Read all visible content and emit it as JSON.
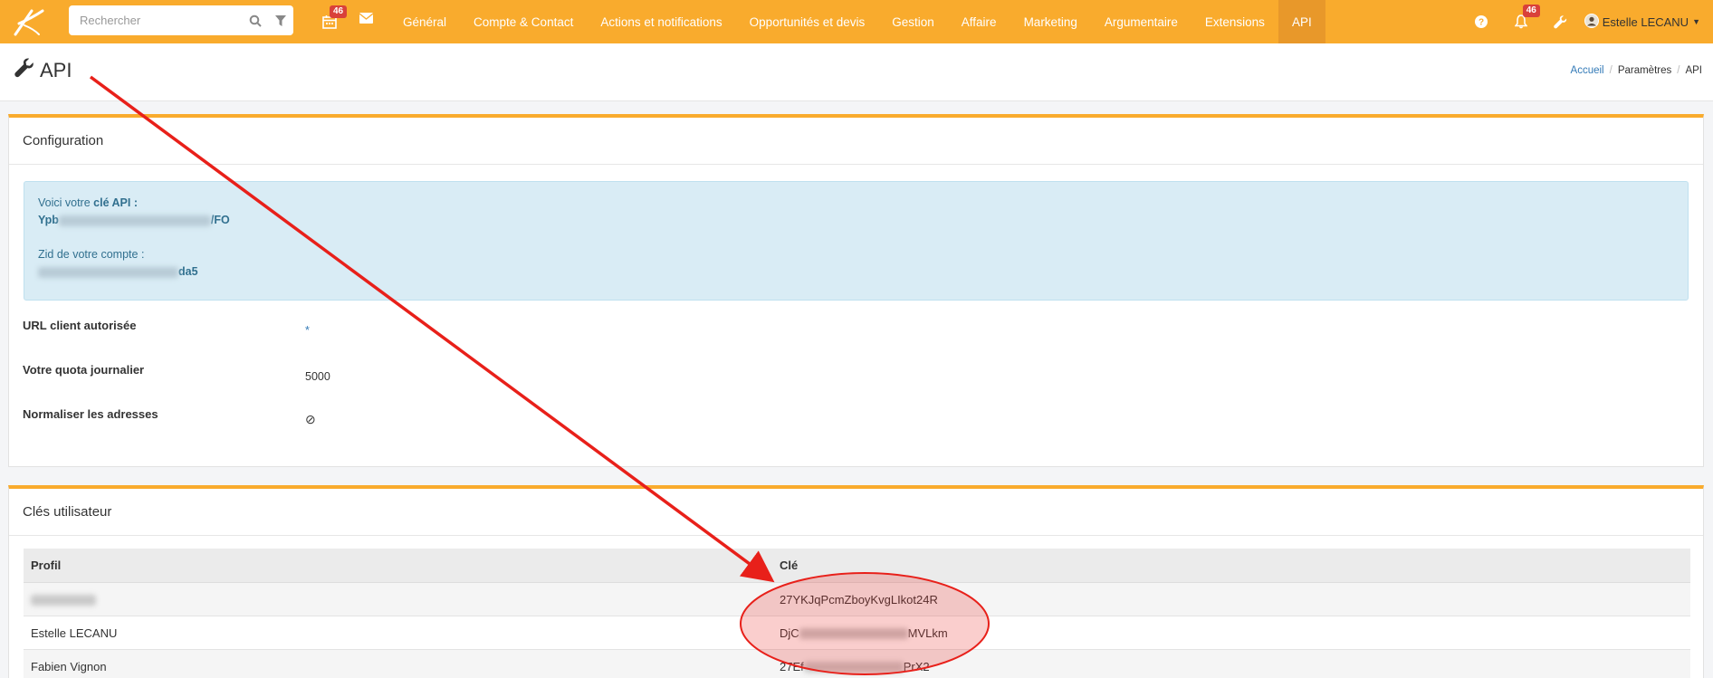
{
  "nav": {
    "search_placeholder": "Rechercher",
    "calendar_badge": "46",
    "notifications_badge": "46",
    "menu": [
      "Général",
      "Compte & Contact",
      "Actions et notifications",
      "Opportunités et devis",
      "Gestion",
      "Affaire",
      "Marketing",
      "Argumentaire",
      "Extensions",
      "API"
    ],
    "active_menu": "API",
    "user_name": "Estelle LECANU"
  },
  "page": {
    "title": "API",
    "breadcrumb": [
      "Accueil",
      "Paramètres",
      "API"
    ]
  },
  "config": {
    "panel_title": "Configuration",
    "api_key_prefix": "Voici votre ",
    "api_key_label": "clé API :",
    "api_key_start": "Ypb",
    "api_key_end": "/FO",
    "zid_label": "Zid de votre compte :",
    "zid_start": "",
    "zid_end": "da5",
    "rows": [
      {
        "label": "URL client autorisée",
        "value": "*"
      },
      {
        "label": "Votre quota journalier",
        "value": "5000"
      },
      {
        "label": "Normaliser les adresses",
        "value": "⊘"
      }
    ]
  },
  "keys": {
    "panel_title": "Clés utilisateur",
    "columns": [
      "Profil",
      "Clé"
    ],
    "rows": [
      {
        "profile": "",
        "key": "27YKJqPcmZboyKvgLIkot24R"
      },
      {
        "profile": "Estelle LECANU",
        "key_start": "DjC",
        "key_end": "MVLkm"
      },
      {
        "profile": "Fabien Vignon",
        "key_start": "27Ef",
        "key_end": "PrX2"
      }
    ]
  },
  "colors": {
    "brand": "#f9ab2d",
    "annotation": "#e8201a"
  }
}
